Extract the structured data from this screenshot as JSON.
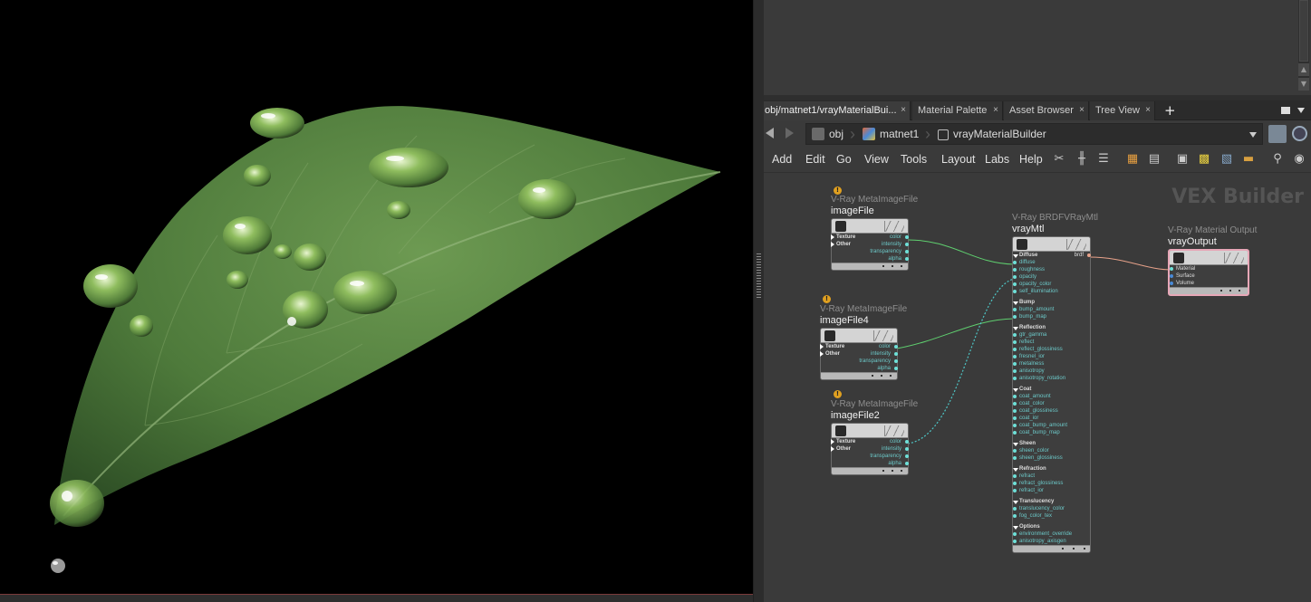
{
  "viewport": {
    "content": "leaf-with-water-droplets-render"
  },
  "tabs": [
    {
      "label": "obj/matnet1/vrayMaterialBui...",
      "active": true
    },
    {
      "label": "Material Palette",
      "active": false
    },
    {
      "label": "Asset Browser",
      "active": false
    },
    {
      "label": "Tree View",
      "active": false
    }
  ],
  "tab_close": "×",
  "tab_add": "+",
  "path": {
    "items": [
      {
        "label": "obj"
      },
      {
        "label": "matnet1"
      },
      {
        "label": "vrayMaterialBuilder"
      }
    ]
  },
  "menu": [
    "Add",
    "Edit",
    "Go",
    "View",
    "Tools",
    "Layout",
    "Labs",
    "Help"
  ],
  "network": {
    "context_label": "VEX Builder",
    "nodes": {
      "imageFile": {
        "type": "V-Ray MetaImageFile",
        "name": "imageFile"
      },
      "imageFile4": {
        "type": "V-Ray MetaImageFile",
        "name": "imageFile4"
      },
      "imageFile2": {
        "type": "V-Ray MetaImageFile",
        "name": "imageFile2"
      },
      "vrayMtl": {
        "type": "V-Ray BRDFVRayMtl",
        "name": "vrayMtl"
      },
      "vrayOutput": {
        "type": "V-Ray Material Output",
        "name": "vrayOutput"
      }
    },
    "image_inputs": [
      "Texture",
      "Other"
    ],
    "image_outputs": [
      "color",
      "intensity",
      "transparency",
      "alpha"
    ],
    "mtl_output": "brdf",
    "mtl_groups": [
      {
        "name": "Diffuse",
        "params": [
          "diffuse",
          "roughness",
          "opacity",
          "opacity_color",
          "self_illumination"
        ]
      },
      {
        "name": "Bump",
        "params": [
          "bump_amount",
          "bump_map"
        ]
      },
      {
        "name": "Reflection",
        "params": [
          "gtr_gamma",
          "reflect",
          "reflect_glossiness",
          "fresnel_ior",
          "metalness",
          "anisotropy",
          "anisotropy_rotation"
        ]
      },
      {
        "name": "Coat",
        "params": [
          "coat_amount",
          "coat_color",
          "coat_glossiness",
          "coat_ior",
          "coat_bump_amount",
          "coat_bump_map"
        ]
      },
      {
        "name": "Sheen",
        "params": [
          "sheen_color",
          "sheen_glossiness"
        ]
      },
      {
        "name": "Refraction",
        "params": [
          "refract",
          "refract_glossiness",
          "refract_ior"
        ]
      },
      {
        "name": "Translucency",
        "params": [
          "translucency_color",
          "fog_color_tex"
        ]
      },
      {
        "name": "Options",
        "params": [
          "environment_override",
          "anisotropy_axisgen"
        ]
      }
    ],
    "output_inputs": [
      "Material",
      "Surface",
      "Volume"
    ]
  },
  "colors": {
    "wire_solid": "#5fcf6f",
    "wire_dotted": "#4ec6c6",
    "wire_out": "#e8a28a",
    "selected": "#e7a7b7"
  }
}
